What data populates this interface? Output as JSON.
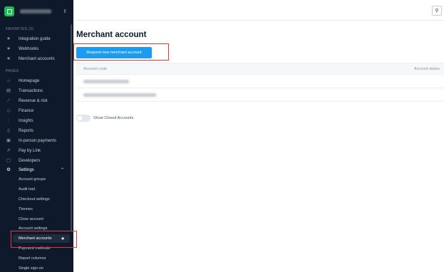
{
  "sidebar": {
    "account_switch_icon": "chevron-updown-icon",
    "favorites_label": "FAVORITES (3)",
    "favorites": [
      {
        "label": "Integration guide",
        "icon": "star-icon"
      },
      {
        "label": "Webhooks",
        "icon": "star-icon"
      },
      {
        "label": "Merchant accounts",
        "icon": "star-icon"
      }
    ],
    "pages_label": "PAGES",
    "pages": [
      {
        "label": "Homepage",
        "icon": "home-icon"
      },
      {
        "label": "Transactions",
        "icon": "transactions-icon"
      },
      {
        "label": "Revenue & risk",
        "icon": "revenue-icon"
      },
      {
        "label": "Finance",
        "icon": "finance-icon"
      },
      {
        "label": "Insights",
        "icon": "insights-icon"
      },
      {
        "label": "Reports",
        "icon": "reports-icon"
      },
      {
        "label": "In-person payments",
        "icon": "terminal-icon"
      },
      {
        "label": "Pay by Link",
        "icon": "link-icon"
      },
      {
        "label": "Developers",
        "icon": "developers-icon"
      },
      {
        "label": "Settings",
        "icon": "gear-icon"
      }
    ],
    "settings_items": [
      "Account groups",
      "Audit trail",
      "Checkout settings",
      "Themes",
      "Close account",
      "Account settings",
      "Merchant accounts",
      "Payment methods",
      "Report columns",
      "Single sign-on"
    ]
  },
  "main": {
    "title": "Merchant account",
    "request_button": "Request new merchant account",
    "table": {
      "headers": [
        "Account code",
        "Account status"
      ]
    },
    "toggle_label": "Show Closed Accounts"
  },
  "colors": {
    "sidebar_bg": "#0e1a2b",
    "primary_button": "#1c9bef",
    "highlight": "#e53935",
    "logo": "#1db954"
  }
}
